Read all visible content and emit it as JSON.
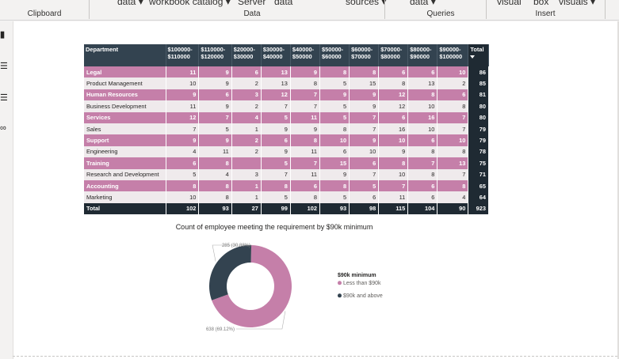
{
  "ribbon": {
    "top_fragments": [
      "data ▾",
      "workbook catalog ▾",
      "Server",
      "data",
      "sources ▾",
      "data ▾",
      "visual",
      "box",
      "visuals ▾"
    ],
    "groups": [
      "Clipboard",
      "Data",
      "Queries",
      "Insert"
    ]
  },
  "colors": {
    "pink": "#c57fa9",
    "navy": "#334350",
    "dark": "#1f2a33",
    "grey_row": "#efeaec"
  },
  "matrix": {
    "headers": [
      "Department",
      "$100000-\n$110000",
      "$110000-\n$120000",
      "$20000-\n$30000",
      "$30000-\n$40000",
      "$40000-\n$50000",
      "$50000-\n$60000",
      "$60000-\n$70000",
      "$70000-\n$80000",
      "$80000-\n$90000",
      "$90000-\n$100000",
      "Total"
    ],
    "rows": [
      {
        "style": "pink",
        "cells": [
          "Legal",
          "11",
          "9",
          "6",
          "13",
          "9",
          "8",
          "8",
          "6",
          "6",
          "10",
          "86"
        ]
      },
      {
        "style": "grey",
        "cells": [
          "Product Management",
          "10",
          "9",
          "2",
          "13",
          "8",
          "5",
          "15",
          "8",
          "13",
          "2",
          "85"
        ]
      },
      {
        "style": "pink",
        "cells": [
          "Human Resources",
          "9",
          "6",
          "3",
          "12",
          "7",
          "9",
          "9",
          "12",
          "8",
          "6",
          "81"
        ]
      },
      {
        "style": "grey",
        "cells": [
          "Business Development",
          "11",
          "9",
          "2",
          "7",
          "7",
          "5",
          "9",
          "12",
          "10",
          "8",
          "80"
        ]
      },
      {
        "style": "pink",
        "cells": [
          "Services",
          "12",
          "7",
          "4",
          "5",
          "11",
          "5",
          "7",
          "6",
          "16",
          "7",
          "80"
        ]
      },
      {
        "style": "grey",
        "cells": [
          "Sales",
          "7",
          "5",
          "1",
          "9",
          "9",
          "8",
          "7",
          "16",
          "10",
          "7",
          "79"
        ]
      },
      {
        "style": "pink",
        "cells": [
          "Support",
          "9",
          "9",
          "2",
          "6",
          "8",
          "10",
          "9",
          "10",
          "6",
          "10",
          "79"
        ]
      },
      {
        "style": "grey",
        "cells": [
          "Engineering",
          "4",
          "11",
          "2",
          "9",
          "11",
          "6",
          "10",
          "9",
          "8",
          "8",
          "78"
        ]
      },
      {
        "style": "pink",
        "cells": [
          "Training",
          "6",
          "8",
          "",
          "5",
          "7",
          "15",
          "6",
          "8",
          "7",
          "13",
          "75"
        ]
      },
      {
        "style": "grey",
        "cells": [
          "Research and Development",
          "5",
          "4",
          "3",
          "7",
          "11",
          "9",
          "7",
          "10",
          "8",
          "7",
          "71"
        ]
      },
      {
        "style": "pink",
        "cells": [
          "Accounting",
          "8",
          "8",
          "1",
          "8",
          "6",
          "8",
          "5",
          "7",
          "6",
          "8",
          "65"
        ]
      },
      {
        "style": "grey",
        "cells": [
          "Marketing",
          "10",
          "8",
          "1",
          "5",
          "8",
          "5",
          "6",
          "11",
          "6",
          "4",
          "64"
        ]
      }
    ],
    "total_row": [
      "Total",
      "102",
      "93",
      "27",
      "99",
      "102",
      "93",
      "98",
      "115",
      "104",
      "90",
      "923"
    ]
  },
  "chart_data": {
    "type": "pie",
    "title": "Count of employee meeting the requirement by $90k minimum",
    "legend_title": "$90k minimum",
    "legend_position": "right",
    "series": [
      {
        "name": "Less than $90k",
        "value": 638,
        "label": "638 (69.12%)",
        "color": "#c57fa9"
      },
      {
        "name": "$90k and above",
        "value": 285,
        "label": "285 (30.88%)",
        "color": "#334350"
      }
    ]
  }
}
